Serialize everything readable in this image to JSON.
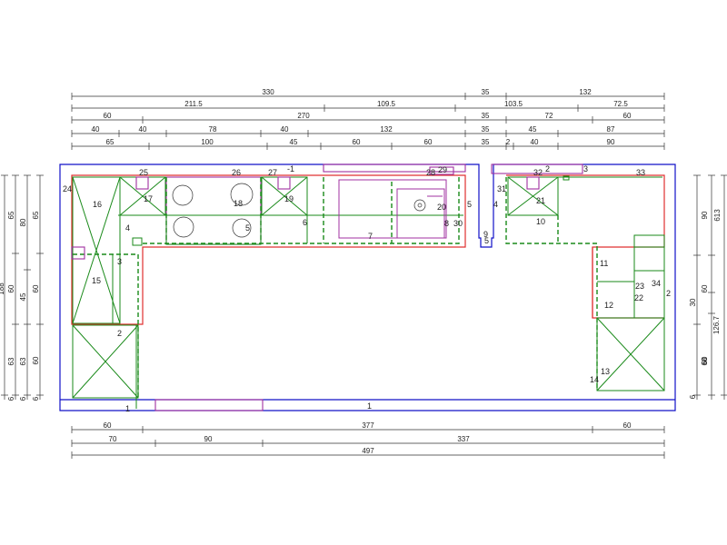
{
  "dimensions": {
    "top": [
      [
        "330",
        "35",
        "132"
      ],
      [
        "211.5",
        "109.5",
        "103.5",
        "72.5"
      ],
      [
        "60",
        "270",
        "35",
        "72",
        "60"
      ],
      [
        "40",
        "40",
        "78",
        "40",
        "132",
        "35",
        "45",
        "87"
      ],
      [
        "65",
        "100",
        "45",
        "60",
        "60",
        "35",
        "2",
        "40",
        "90"
      ]
    ],
    "bottom": [
      [
        "60",
        "377",
        "60"
      ],
      [
        "70",
        "90",
        "337"
      ],
      [
        "497"
      ]
    ],
    "left": [
      [
        "80",
        "65",
        "63",
        "6"
      ],
      [
        "45",
        "60",
        "63"
      ],
      [
        "65",
        "60",
        "60",
        "6"
      ],
      [
        "188",
        "6"
      ]
    ],
    "right": [
      [
        "90",
        "60",
        "60"
      ],
      [
        "613",
        "30",
        "68"
      ],
      [
        "126.7",
        "6"
      ]
    ]
  },
  "labels": {
    "n1a": "1",
    "n1b": "1",
    "n2a": "2",
    "n2b": "2",
    "n2c": "2",
    "n3a": "3",
    "n3b": "3",
    "n4a": "4",
    "n4b": "4",
    "n5a": "5",
    "n5b": "5",
    "n5c": "5",
    "n6": "6",
    "n7": "7",
    "n8": "8",
    "n9": "9",
    "n10": "10",
    "n11": "11",
    "n12": "12",
    "n13": "13",
    "n14": "14",
    "n15": "15",
    "n16": "16",
    "n17": "17",
    "n18": "18",
    "n19": "19",
    "n20": "20",
    "n21": "21",
    "n22": "22",
    "n23": "23",
    "n24": "24",
    "n25": "25",
    "n26": "26",
    "n27": "27",
    "n28": "28",
    "n29": "29",
    "n30": "30",
    "n31": "31",
    "n32": "32",
    "n33": "33",
    "n34": "34",
    "nm1": "-1"
  }
}
